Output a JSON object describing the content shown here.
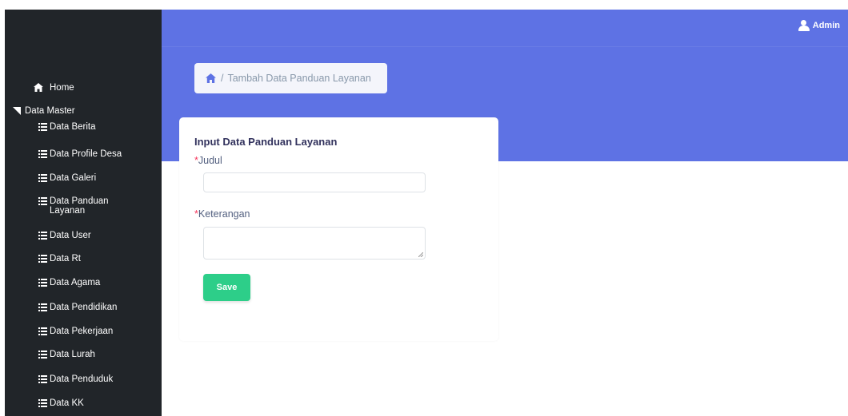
{
  "sidebar": {
    "home": {
      "label": "Home",
      "icon": "home-icon"
    },
    "master": {
      "label": "Data Master",
      "icon": "caret-down-icon"
    },
    "items": [
      {
        "label": "Data Berita"
      },
      {
        "label": "Data Profile Desa"
      },
      {
        "label": "Data Galeri"
      },
      {
        "label": "Data Panduan Layanan"
      },
      {
        "label": "Data User"
      },
      {
        "label": "Data Rt"
      },
      {
        "label": "Data Agama"
      },
      {
        "label": "Data Pendidikan"
      },
      {
        "label": "Data Pekerjaan"
      },
      {
        "label": "Data Lurah"
      },
      {
        "label": "Data Penduduk"
      },
      {
        "label": "Data KK"
      }
    ]
  },
  "topbar": {
    "user_label": "Admin",
    "user_icon": "user-icon"
  },
  "breadcrumb": {
    "separator": "/",
    "current": "Tambah Data Panduan Layanan",
    "icon": "home-icon"
  },
  "form": {
    "title": "Input Data Panduan Layanan",
    "required_mark": "*",
    "judul_label": "Judul",
    "judul_value": "",
    "keterangan_label": "Keterangan",
    "keterangan_value": "",
    "save_label": "Save"
  },
  "colors": {
    "sidebar_bg": "#212529",
    "header_bg": "#5e72e4",
    "save_btn": "#2dce89",
    "required": "#f5365c"
  }
}
